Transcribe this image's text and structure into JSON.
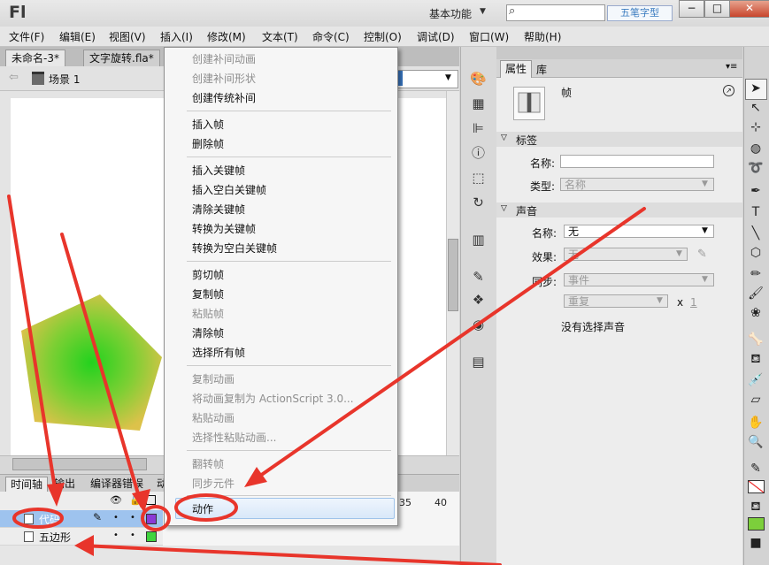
{
  "app": {
    "logo": "Fl",
    "workspace": "基本功能",
    "watermark": "五笔字型",
    "window_buttons": [
      "−",
      "□",
      "✕"
    ]
  },
  "menubar": {
    "items": [
      "文件(F)",
      "编辑(E)",
      "视图(V)",
      "插入(I)",
      "修改(M)",
      "文本(T)",
      "命令(C)",
      "控制(O)",
      "调试(D)",
      "窗口(W)",
      "帮助(H)"
    ]
  },
  "document": {
    "tabs": [
      "未命名-3*",
      "文字旋转.fla*"
    ],
    "scene": "场景 1"
  },
  "context_menu": {
    "items": [
      {
        "label": "创建补间动画",
        "enabled": false
      },
      {
        "label": "创建补间形状",
        "enabled": false
      },
      {
        "label": "创建传统补间",
        "enabled": true
      },
      {
        "label": "插入帧",
        "enabled": true
      },
      {
        "label": "删除帧",
        "enabled": true
      },
      {
        "label": "插入关键帧",
        "enabled": true
      },
      {
        "label": "插入空白关键帧",
        "enabled": true
      },
      {
        "label": "清除关键帧",
        "enabled": true
      },
      {
        "label": "转换为关键帧",
        "enabled": true
      },
      {
        "label": "转换为空白关键帧",
        "enabled": true
      },
      {
        "label": "剪切帧",
        "enabled": true
      },
      {
        "label": "复制帧",
        "enabled": true
      },
      {
        "label": "粘贴帧",
        "enabled": false
      },
      {
        "label": "清除帧",
        "enabled": true
      },
      {
        "label": "选择所有帧",
        "enabled": true
      },
      {
        "label": "复制动画",
        "enabled": false
      },
      {
        "label": "将动画复制为 ActionScript 3.0...",
        "enabled": false
      },
      {
        "label": "粘贴动画",
        "enabled": false
      },
      {
        "label": "选择性粘贴动画...",
        "enabled": false
      },
      {
        "label": "翻转帧",
        "enabled": false
      },
      {
        "label": "同步元件",
        "enabled": false
      },
      {
        "label": "动作",
        "enabled": true,
        "highlighted": true
      }
    ]
  },
  "timeline": {
    "tabs": [
      "时间轴",
      "输出",
      "编译器错误",
      "动"
    ],
    "layers": [
      {
        "name": "代码",
        "selected": true,
        "color": "#8a3bd6"
      },
      {
        "name": "五边形",
        "selected": false,
        "color": "#3fd43f"
      }
    ],
    "ticks": [
      "35",
      "40"
    ]
  },
  "properties": {
    "tabs": [
      "属性",
      "库"
    ],
    "frame_label": "帧",
    "section_label": "标签",
    "name_label": "名称:",
    "name_value": "",
    "type_label": "类型:",
    "type_value": "名称",
    "section_sound": "声音",
    "sound_name_label": "名称:",
    "sound_name_value": "无",
    "effect_label": "效果:",
    "effect_value": "无",
    "sync_label": "同步:",
    "sync_value": "事件",
    "repeat_value": "重复",
    "repeat_x": "x",
    "repeat_count": "1",
    "no_sound": "没有选择声音"
  },
  "colors": {
    "arrow": "#e8352b",
    "selection": "#9ec3ee",
    "pentagon_center": "#2fd42b",
    "pentagon_edge": "#d9c248"
  }
}
